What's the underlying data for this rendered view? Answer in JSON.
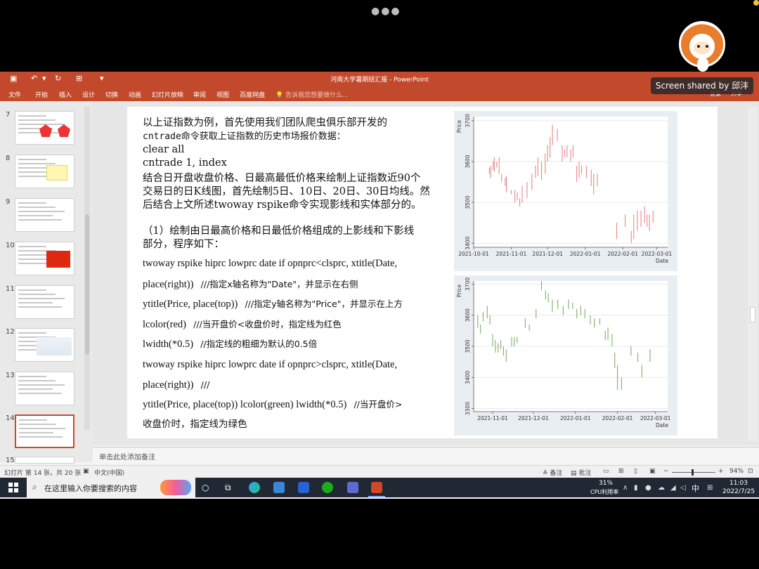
{
  "window": {
    "title": "河南大学暑期班汇报 - PowerPoint",
    "share_badge": "Screen shared by 邱沣"
  },
  "ribbon": {
    "tabs": [
      "文件",
      "开始",
      "插入",
      "设计",
      "切换",
      "动画",
      "幻灯片放映",
      "审阅",
      "视图",
      "百度网盘"
    ],
    "tellme": "告诉我您想要做什么...",
    "right": [
      "登录",
      "共享"
    ]
  },
  "sidebar": {
    "slides": [
      7,
      8,
      9,
      10,
      11,
      12,
      13,
      14,
      15
    ],
    "active": 14
  },
  "slide": {
    "intro_lines": [
      "以上证指数为例，首先使用我们团队爬虫俱乐部开发的",
      "cntrade命令获取上证指数的历史市场报价数据："
    ],
    "cmd1": "clear all",
    "cmd2": "cntrade 1, index",
    "desc_lines": [
      "结合日开盘收盘价格、日最高最低价格来绘制上证指数近90个",
      "交易日的日K线图，首先绘制5日、10日、20日、30日均线。然",
      "后结合上文所述twoway rspike命令实现影线和实体部分的。"
    ],
    "step_lines": [
      "（1）绘制由日最高价格和日最低价格组成的上影线和下影线",
      "部分，程序如下："
    ],
    "code": [
      {
        "code": "twoway rspike hiprc lowprc date if opnprc<clsprc, xtitle(Date,",
        "comment": ""
      },
      {
        "code": "place(right))",
        "comment": "///指定x轴名称为\"Date\"，并显示在右侧"
      },
      {
        "code": "ytitle(Price, place(top))",
        "comment": "///指定y轴名称为\"Price\"，并显示在上方"
      },
      {
        "code": "lcolor(red)",
        "comment": "///当开盘价<收盘价时，指定线为红色"
      },
      {
        "code": "lwidth(*0.5)",
        "comment": "//指定线的粗细为默认的0.5倍"
      },
      {
        "code": "twoway rspike hiprc lowprc date if opnprc>clsprc, xtitle(Date,",
        "comment": ""
      },
      {
        "code": "place(right))",
        "comment": "///"
      },
      {
        "code": " ytitle(Price, place(top)) lcolor(green) lwidth(*0.5)",
        "comment": "//当开盘价>"
      },
      {
        "code": "收盘价时，指定线为绿色",
        "comment": ""
      }
    ]
  },
  "notes": {
    "placeholder": "单击此处添加备注"
  },
  "status": {
    "slide_info": "幻灯片 第 14 张，共 20 张",
    "language": "中文(中国)",
    "notes_btn": "备注",
    "comments_btn": "批注",
    "zoom": "94%"
  },
  "taskbar": {
    "search_placeholder": "在这里输入你要搜索的内容",
    "cpu": "31%",
    "cpu_label": "CPU利用率",
    "ime": "中",
    "time": "11:03",
    "date": "2022/7/25"
  },
  "colors": {
    "ribbon": "#c3492c",
    "up": "#e8878b",
    "down": "#7fb06a"
  },
  "chart_data": [
    {
      "type": "rspike",
      "ylabel": "Price",
      "xlabel": "Date",
      "ylim": [
        3390,
        3710
      ],
      "yticks": [
        3400,
        3500,
        3600,
        3700
      ],
      "xticks": [
        "2021-10-01",
        "2021-11-01",
        "2021-12-01",
        "2022-01-01",
        "2022-02-01",
        "2022-03-01"
      ],
      "x_range": [
        0,
        160
      ],
      "xtick_pos": [
        0,
        31,
        61,
        92,
        123,
        151
      ],
      "color": "#e8878b",
      "spikes": [
        [
          13,
          3570,
          3585
        ],
        [
          14,
          3560,
          3590
        ],
        [
          16,
          3580,
          3600
        ],
        [
          17,
          3575,
          3610
        ],
        [
          19,
          3585,
          3600
        ],
        [
          21,
          3570,
          3610
        ],
        [
          23,
          3550,
          3570
        ],
        [
          26,
          3540,
          3560
        ],
        [
          27,
          3525,
          3565
        ],
        [
          31,
          3520,
          3530
        ],
        [
          34,
          3500,
          3530
        ],
        [
          36,
          3505,
          3525
        ],
        [
          38,
          3490,
          3510
        ],
        [
          40,
          3500,
          3540
        ],
        [
          44,
          3510,
          3550
        ],
        [
          48,
          3530,
          3570
        ],
        [
          51,
          3560,
          3590
        ],
        [
          53,
          3565,
          3610
        ],
        [
          56,
          3555,
          3600
        ],
        [
          59,
          3570,
          3620
        ],
        [
          61,
          3600,
          3640
        ],
        [
          63,
          3610,
          3660
        ],
        [
          65,
          3640,
          3690
        ],
        [
          69,
          3650,
          3680
        ],
        [
          73,
          3600,
          3640
        ],
        [
          75,
          3610,
          3630
        ],
        [
          77,
          3610,
          3640
        ],
        [
          80,
          3600,
          3630
        ],
        [
          82,
          3610,
          3640
        ],
        [
          85,
          3550,
          3590
        ],
        [
          87,
          3560,
          3600
        ],
        [
          89,
          3570,
          3590
        ],
        [
          93,
          3560,
          3590
        ],
        [
          97,
          3540,
          3580
        ],
        [
          99,
          3520,
          3570
        ],
        [
          102,
          3540,
          3570
        ],
        [
          118,
          3410,
          3450
        ],
        [
          125,
          3440,
          3470
        ],
        [
          130,
          3400,
          3430
        ],
        [
          132,
          3410,
          3470
        ],
        [
          135,
          3430,
          3480
        ],
        [
          138,
          3440,
          3480
        ],
        [
          141,
          3450,
          3490
        ],
        [
          143,
          3440,
          3470
        ],
        [
          145,
          3430,
          3470
        ],
        [
          148,
          3450,
          3480
        ]
      ]
    },
    {
      "type": "rspike",
      "ylabel": "Price",
      "xlabel": "Date",
      "ylim": [
        3290,
        3710
      ],
      "yticks": [
        3300,
        3400,
        3500,
        3600,
        3700
      ],
      "xticks": [
        "2021-11-01",
        "2021-12-01",
        "2022-01-01",
        "2022-02-01",
        "2022-03-01"
      ],
      "x_range": [
        17,
        160
      ],
      "xtick_pos": [
        31,
        61,
        92,
        123,
        151
      ],
      "color": "#7fb06a",
      "spikes": [
        [
          20,
          3560,
          3600
        ],
        [
          22,
          3540,
          3570
        ],
        [
          24,
          3580,
          3610
        ],
        [
          27,
          3590,
          3630
        ],
        [
          29,
          3570,
          3600
        ],
        [
          31,
          3500,
          3540
        ],
        [
          33,
          3480,
          3520
        ],
        [
          35,
          3480,
          3510
        ],
        [
          37,
          3490,
          3520
        ],
        [
          39,
          3470,
          3500
        ],
        [
          41,
          3450,
          3490
        ],
        [
          45,
          3500,
          3530
        ],
        [
          47,
          3500,
          3530
        ],
        [
          49,
          3510,
          3530
        ],
        [
          55,
          3560,
          3590
        ],
        [
          58,
          3550,
          3570
        ],
        [
          63,
          3590,
          3620
        ],
        [
          67,
          3680,
          3710
        ],
        [
          70,
          3650,
          3680
        ],
        [
          72,
          3640,
          3670
        ],
        [
          75,
          3610,
          3650
        ],
        [
          79,
          3620,
          3650
        ],
        [
          83,
          3600,
          3630
        ],
        [
          87,
          3620,
          3650
        ],
        [
          90,
          3620,
          3640
        ],
        [
          93,
          3590,
          3620
        ],
        [
          96,
          3600,
          3630
        ],
        [
          99,
          3590,
          3620
        ],
        [
          103,
          3570,
          3600
        ],
        [
          106,
          3560,
          3590
        ],
        [
          110,
          3570,
          3590
        ],
        [
          114,
          3520,
          3550
        ],
        [
          116,
          3520,
          3560
        ],
        [
          119,
          3500,
          3540
        ],
        [
          121,
          3430,
          3480
        ],
        [
          123,
          3360,
          3440
        ],
        [
          126,
          3360,
          3400
        ],
        [
          133,
          3470,
          3500
        ],
        [
          138,
          3450,
          3480
        ],
        [
          141,
          3400,
          3440
        ],
        [
          147,
          3450,
          3490
        ]
      ]
    }
  ]
}
